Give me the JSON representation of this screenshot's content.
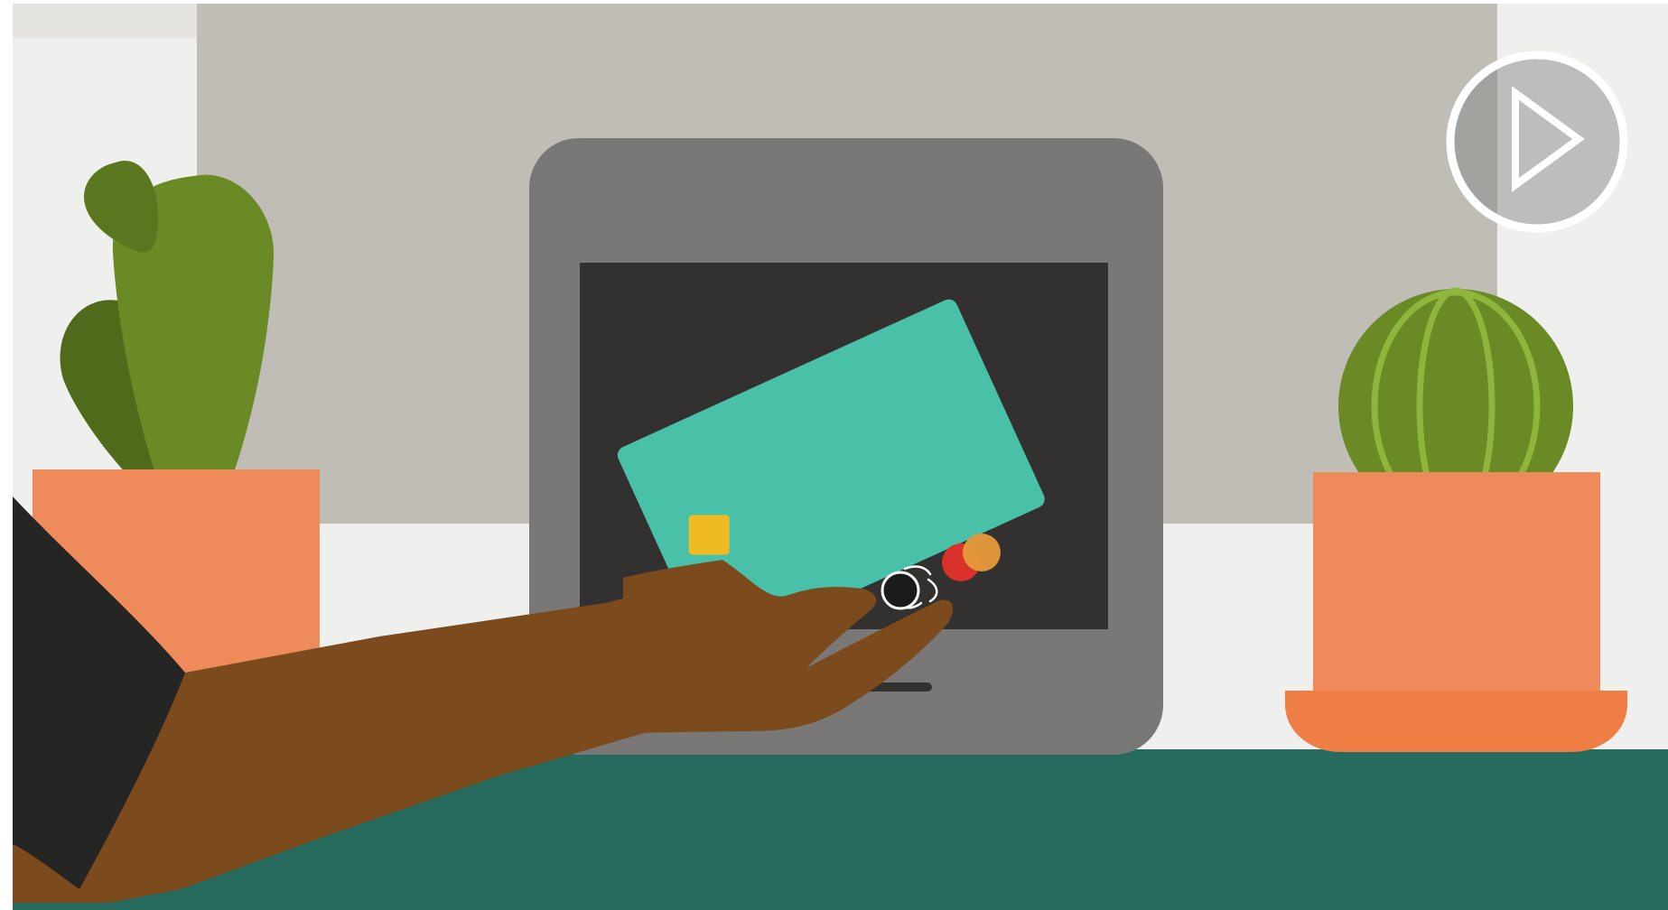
{
  "video": {
    "player_state": "paused",
    "play_button_icon": "play-icon"
  },
  "colors": {
    "wall_left": "#efefee",
    "wall_panel": "#c0bdb7",
    "counter": "#276b5f",
    "terminal_body": "#7a7876",
    "terminal_screen": "#323130",
    "card": "#49c1a8",
    "card_chip": "#f0bb22",
    "logo_red": "#e21a23",
    "logo_orange": "#f4983f",
    "pot": "#ef8b5b",
    "pot_saucer": "#ef7e45",
    "cactus_green": "#6a8a25",
    "cactus_dark_green": "#4f6a1b",
    "cactus_rib": "#8fb63c",
    "skin": "#7b4a1d",
    "sleeve": "#252523",
    "play_button": "#ffffff"
  }
}
